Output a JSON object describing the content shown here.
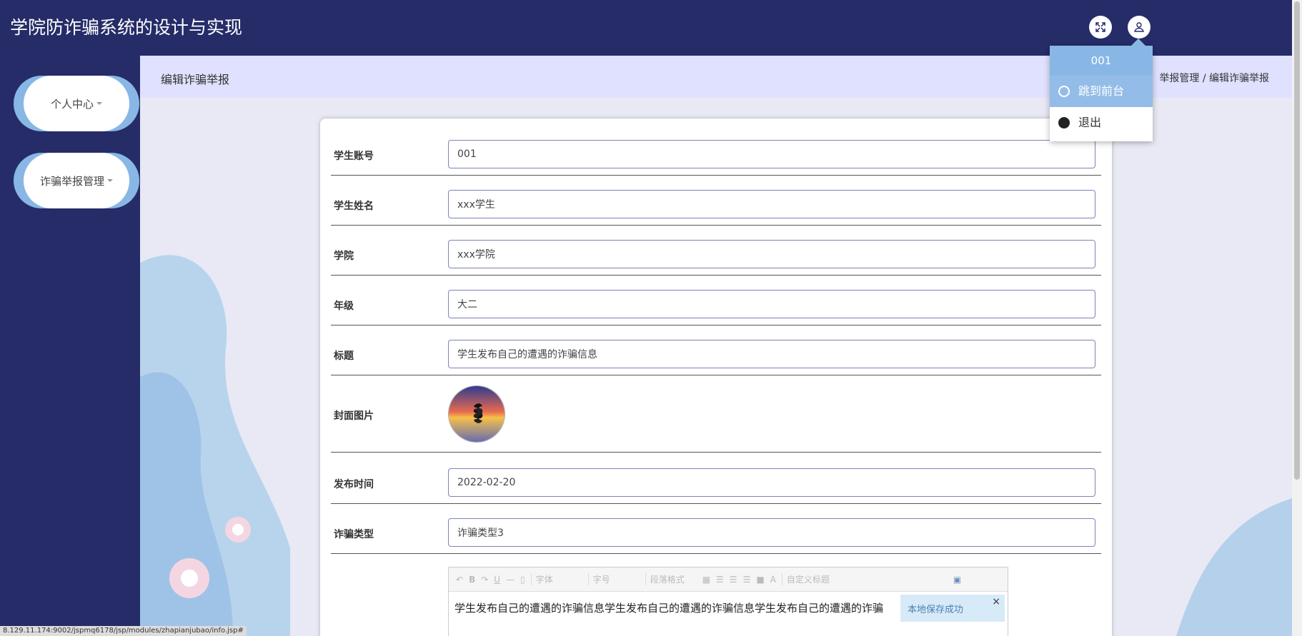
{
  "app": {
    "title": "学院防诈骗系统的设计与实现"
  },
  "header_icons": {
    "fullscreen": "fullscreen-icon",
    "user": "user-icon"
  },
  "sidebar": {
    "items": [
      {
        "label": "个人中心"
      },
      {
        "label": "诈骗举报管理"
      }
    ]
  },
  "page": {
    "title": "编辑诈骗举报",
    "breadcrumb": "举报管理 / 编辑诈骗举报"
  },
  "form": {
    "fields": [
      {
        "label": "学生账号",
        "value": "001"
      },
      {
        "label": "学生姓名",
        "value": "xxx学生"
      },
      {
        "label": "学院",
        "value": "xxx学院"
      },
      {
        "label": "年级",
        "value": "大二"
      },
      {
        "label": "标题",
        "value": "学生发布自己的遭遇的诈骗信息"
      },
      {
        "label": "封面图片",
        "value": ""
      },
      {
        "label": "发布时间",
        "value": "2022-02-20"
      },
      {
        "label": "诈骗类型",
        "value": "诈骗类型3"
      }
    ]
  },
  "editor": {
    "toolbar": {
      "font": "字体",
      "size": "字号",
      "paragraph": "段落格式",
      "custom_title": "自定义标题"
    },
    "content": "学生发布自己的遭遇的诈骗信息学生发布自己的遭遇的诈骗信息学生发布自己的遭遇的诈骗",
    "save_tip": "本地保存成功"
  },
  "user_menu": {
    "username": "001",
    "items": [
      {
        "label": "跳到前台",
        "icon": "power-icon"
      },
      {
        "label": "退出",
        "icon": "power-icon"
      }
    ]
  },
  "status": {
    "url": "8.129.11.174:9002/jspmq6178/jsp/modules/zhapianjubao/info.jsp#"
  },
  "colors": {
    "header_bg": "#252c68",
    "accent": "#88b7e5",
    "breadcrumb_bg": "#dfe1fe",
    "content_bg": "#e8e9f4"
  }
}
